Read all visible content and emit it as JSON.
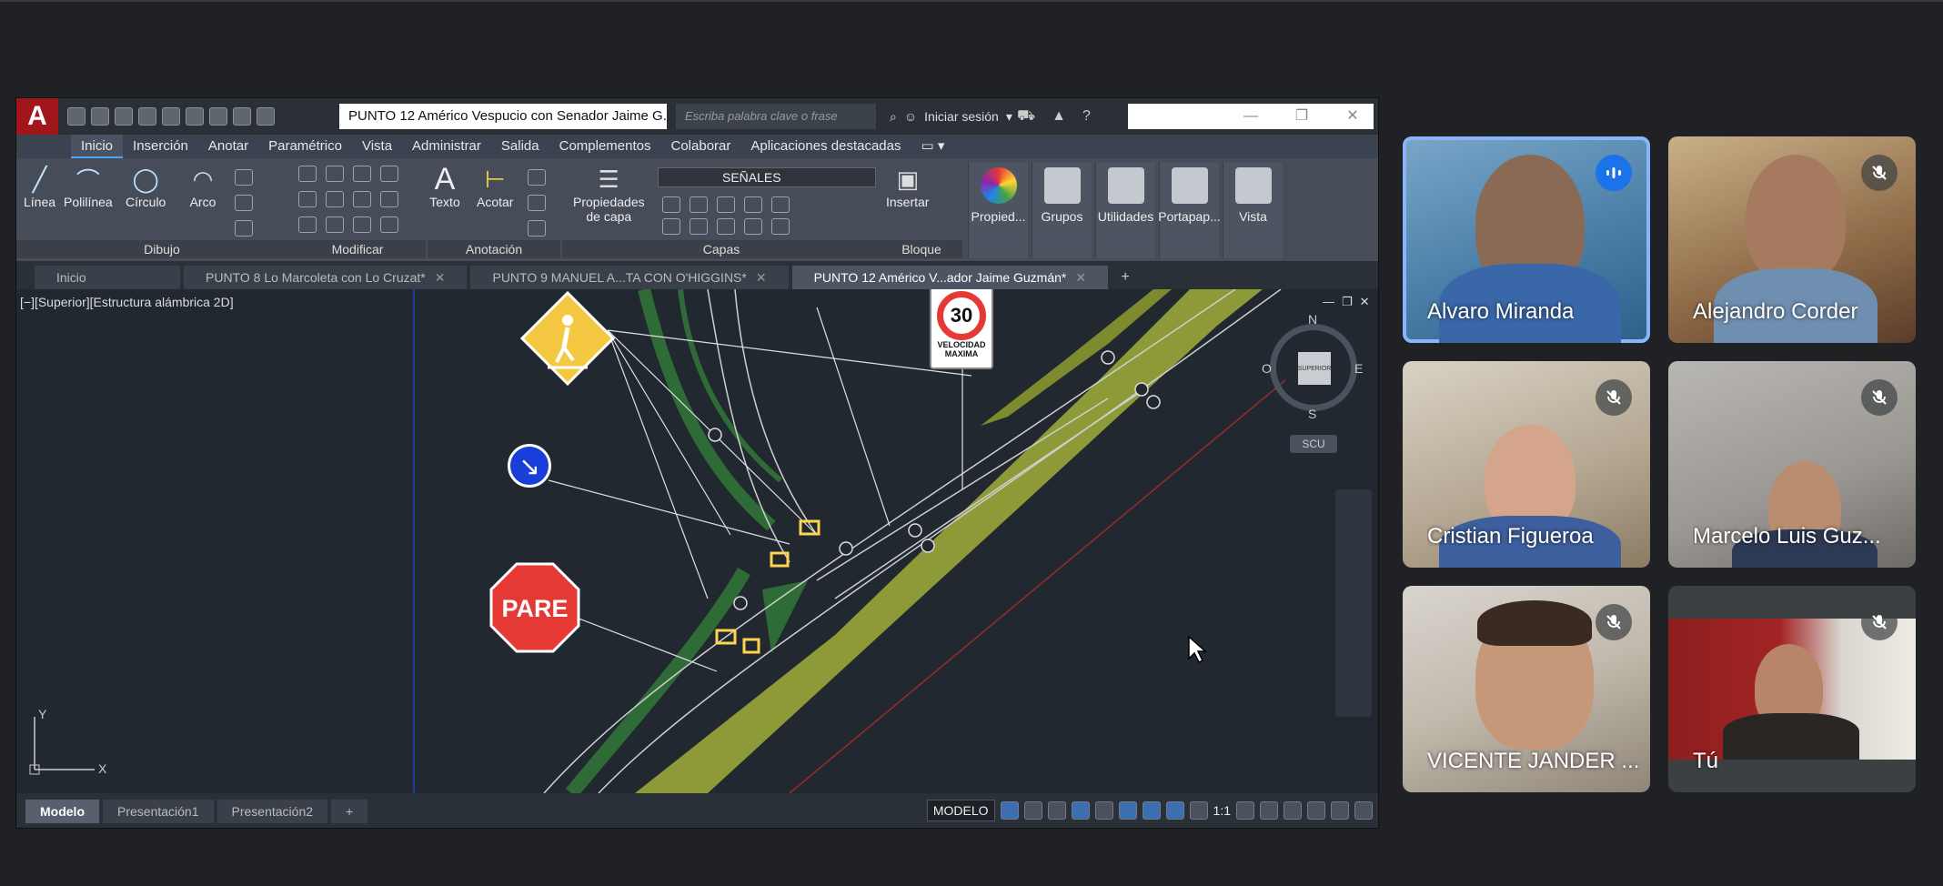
{
  "autocad": {
    "app_logo": "A",
    "document_title": "PUNTO 12 Américo Vespucio con Senador Jaime G...",
    "search_placeholder": "Escriba palabra clave o frase",
    "signin_label": "Iniciar sesión",
    "menu_tabs": [
      "Inicio",
      "Inserción",
      "Anotar",
      "Paramétrico",
      "Vista",
      "Administrar",
      "Salida",
      "Complementos",
      "Colaborar",
      "Aplicaciones destacadas"
    ],
    "ribbon": {
      "draw_tools": [
        "Línea",
        "Polilínea",
        "Círculo",
        "Arco"
      ],
      "panel_dibujo": "Dibujo",
      "panel_modificar": "Modificar",
      "text_tool": "Texto",
      "dim_tool": "Acotar",
      "panel_anotacion": "Anotación",
      "layer_props_line1": "Propiedades",
      "layer_props_line2": "de capa",
      "layer_current": "SEÑALES",
      "panel_capas": "Capas",
      "insert_tool": "Insertar",
      "panel_bloque": "Bloque",
      "big_buttons": [
        "Propied...",
        "Grupos",
        "Utilidades",
        "Portapap...",
        "Vista"
      ]
    },
    "doc_tabs": [
      "Inicio",
      "PUNTO 8 Lo Marcoleta con Lo Cruzat*",
      "PUNTO 9 MANUEL A...TA CON O'HIGGINS*",
      "PUNTO 12 Américo V...ador Jaime Guzmán*"
    ],
    "viewport_label": "[−][Superior][Estructura alámbrica 2D]",
    "viewcube": {
      "top_face": "SUPERIOR",
      "north": "N",
      "south": "S",
      "east": "E",
      "west": "O",
      "ucs": "SCU"
    },
    "signs": {
      "speed": "30",
      "speed_caption_1": "VELOCIDAD",
      "speed_caption_2": "MAXIMA",
      "stop": "PARE"
    },
    "ucs_axes": {
      "x": "X",
      "y": "Y"
    },
    "layout_tabs": [
      "Modelo",
      "Presentación1",
      "Presentación2"
    ],
    "status_mode": "MODELO",
    "scale": "1:1"
  },
  "participants": [
    {
      "name": "Alvaro Miranda",
      "speaking": true
    },
    {
      "name": "Alejandro Corder",
      "muted": true
    },
    {
      "name": "Cristian Figueroa",
      "muted": true
    },
    {
      "name": "Marcelo Luis Guz...",
      "muted": true
    },
    {
      "name": "VICENTE JANDER ...",
      "muted": true
    },
    {
      "name": "Tú",
      "muted": true
    }
  ],
  "colors": {
    "speaking_outline": "#8ab4f8",
    "accent": "#1a73e8",
    "stop_sign": "#e53935",
    "road_yellow": "#9aa63a",
    "road_green": "#2e6b36"
  }
}
